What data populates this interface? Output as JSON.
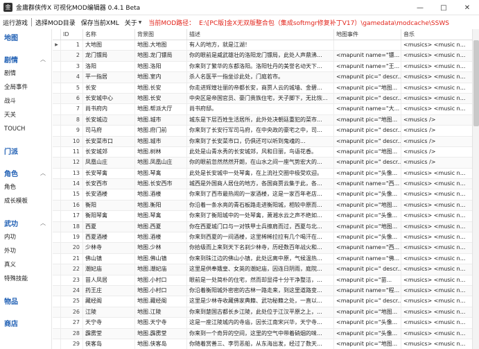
{
  "window": {
    "icon": "金",
    "title": "金庸群侠传X 可视化MOD编辑器 0.4.1 Beta",
    "buttons": [
      "—",
      "□",
      "✕"
    ]
  },
  "menu": {
    "run_game": "运行游戏",
    "select_mod": "选择MOD目录",
    "save_xml": "保存当前XML",
    "about": "关于",
    "path_label": "当前MOD路径：",
    "path_value": "E:\\[PC版]金X无双版整合包（集成softmgr修复补丁V17）\\gamedata\\modcache\\SSWS"
  },
  "sidebar": {
    "g1": "地图",
    "g2": "剧情",
    "g2_items": [
      "剧情",
      "全局事件",
      "战斗",
      "天关",
      "TOUCH"
    ],
    "g3": "门派",
    "g4": "角色",
    "g4_items": [
      "角色",
      "成长模板"
    ],
    "g5": "武功",
    "g5_items": [
      "内功",
      "外功",
      "真义",
      "特殊技能"
    ],
    "g6": "物品",
    "g7": "商店"
  },
  "grid": {
    "headers": [
      "ID",
      "名称",
      "背景图",
      "描述",
      "地图事件",
      "音乐"
    ],
    "rows": [
      [
        "1",
        "大地图",
        "地图.大地图",
        "有人的地方，就是江湖！",
        "",
        "<musics>  <music n..."
      ],
      [
        "2",
        "龙门镖局",
        "地图.龙门镖局",
        "你的眼前是威武雄壮的洛阳龙门镖局，此处人声鼎沸...",
        "<mapunit name=\"镖...",
        "<musics>  <music n..."
      ],
      [
        "3",
        "洛阳",
        "地图.洛阳",
        "你来到了繁华的东都洛阳。洛阳牡丹的美誉名动天下...",
        "<mapunit name=\"王...",
        "<musics>  <music n..."
      ],
      [
        "4",
        "平一指居",
        "地图.室内",
        "杀人名医平一指坐诊此处，门庭若市。",
        "<mapunit pic=\" descr...",
        "<musics>  <music n..."
      ],
      [
        "5",
        "长安",
        "地图.长安",
        "你走进辉煌壮丽的帝都长安，商贾人云的城墙、金碧...",
        "<mapunit pic=\"地图...",
        "<musics>  <music n..."
      ],
      [
        "6",
        "长安城中心",
        "地图.长安",
        "中央区是帝国官员、豪门贵族住宅，天子脚下，无比恢...",
        "<mapunit pic=\" descr...",
        "<musics>  <music n..."
      ],
      [
        "7",
        "尚书府内",
        "地图.帮派大厅",
        "尚书府邸。",
        "<mapunit name=\"大...",
        "<musics>  <music n..."
      ],
      [
        "8",
        "长安城边",
        "地图.城市",
        "城东是下层百姓生活居所，此外处决朝廷重犯的菜市...",
        "<mapunit pic=\"地图...",
        "<musics />"
      ],
      [
        "9",
        "司马府",
        "地图.府门前",
        "你来到了长安行军司马府，在中央政的豪宅之中，司...",
        "<mapunit pic=\" descr...",
        "<musics />"
      ],
      [
        "10",
        "长安菜市口",
        "地图.城市",
        "你来到了长安菜市口，仍俱还可以听到鬼魂的...",
        "<mapunit pic=\" descr...",
        "<musics />"
      ],
      [
        "11",
        "长安城郊",
        "地图.树林",
        "此处是山青水秀的长安城郊，风和日丽，鸟语花香。",
        "<mapunit pic=\"地图...",
        "<musics />"
      ],
      [
        "12",
        "凤凰山庄",
        "地图.凤凰山庄",
        "你的眼前忽然然然开朗，在山水之间一座气势宏大的...",
        "<mapunit pic=\" descr...",
        "<musics />"
      ],
      [
        "13",
        "长安琴禽",
        "地图.琴禽",
        "此处是长安城中一处琴禽，在上流社交圈中极受欢迎。",
        "<mapunit pic=\"头像...",
        "<musics>  <music n..."
      ],
      [
        "14",
        "长安西市",
        "地图.长安西市",
        "城西是外国商人居住的地方，各国商贾云集于此，各...",
        "<mapunit name=\"西...",
        "<musics>  <music n..."
      ],
      [
        "15",
        "长安酒楼",
        "地图.酒楼",
        "你来到了西市最热闹的一家酒楼，这是一家百年老店...",
        "<mapunit pic=\"头像...",
        "<musics>  <music n..."
      ],
      [
        "16",
        "衡阳",
        "地图.衡阳",
        "你沿着一条水亮的青石板路走进衡阳城，相较中原而...",
        "<mapunit pic=\"地图...",
        "<musics>  <music n..."
      ],
      [
        "17",
        "衡阳琴禽",
        "地图.琴禽",
        "你来到了衡阳城中的一处琴禽，萧湘水云之声不绝如...",
        "<mapunit pic=\"头像...",
        "<musics>  <music n..."
      ],
      [
        "18",
        "西夏",
        "地图.西夏",
        "你在西夏城门口与一对铁甲士兵擦肩而过，西夏与北...",
        "<mapunit pic=\"地图...",
        "<musics>  <music n..."
      ],
      [
        "19",
        "西夏酒楼",
        "地图.酒楼",
        "你来到西夏的一间酒楼，这里稀稀拉拉有几个喝汗在...",
        "<mapunit pic=\"头像...",
        "<musics>  <music n..."
      ],
      [
        "20",
        "少林寺",
        "地图.少林",
        "你拾级而上来到天下名刹少林寺，历经数百年战火和...",
        "<mapunit name=\"西...",
        "<musics>  <music n..."
      ],
      [
        "21",
        "佛山镇",
        "地图.佛山镇",
        "你来到珠江边的佛山小镇，此处远离中原，气候温热...",
        "<mapunit name=\"佛...",
        "<musics>  <music n..."
      ],
      [
        "22",
        "潮妃庙",
        "地图.潮妃庙",
        "这里是供奉娥皇、女英的潮妃庙，因连日阴雨，庭院...",
        "<mapunit pic=\" descr...",
        "<musics>  <music n..."
      ],
      [
        "23",
        "苗人凤居",
        "地图.小村口",
        "眼前是一处简朴的住宅，然而却显得十分干净整洁，...",
        "<mapunit pic=\"苗...",
        "<musics>  <music n..."
      ],
      [
        "24",
        "药王庄",
        "地图.小村口",
        "你沿着衡阳城外密密的古林一路走来，到这里道路变...",
        "<mapunit name=\"程...",
        "<musics>  <music n..."
      ],
      [
        "25",
        "藏经阁",
        "地图.藏经阁",
        "这里是少林寺收藏佛家典籍、武功秘籍之处，一直以...",
        "<mapunit pic=\" descr...",
        "<musics>  <music n..."
      ],
      [
        "26",
        "江陵",
        "地图.江陵",
        "你来到楚国古都长乡江陵，此处位于江汉平原之上，...",
        "<mapunit pic=\"地图...",
        "<musics>  <music n..."
      ],
      [
        "27",
        "天宁寺",
        "地图.天宁寺",
        "这是一座江陵城内的寺庙，因长江南宋兴华，天宁寺...",
        "<mapunit pic=\"头像...",
        "<musics>  <music n..."
      ],
      [
        "28",
        "霹雳堂",
        "地图.霹雳堂",
        "你来到一个奇异的空间，这里的空气中带着硝烟的味...",
        "<mapunit pic=\"头像...",
        "<musics>  <music n..."
      ],
      [
        "29",
        "侠客岛",
        "地图.侠客岛",
        "你随着赏善三、李罚恶船，从东海出发，经过了数天...",
        "<mapunit pic=\"地图...",
        "<musics>  <music n..."
      ],
      [
        "30",
        "侠客岛洞内",
        "地图.侠客岛洞内",
        "你在岛中随着走动，来到这个洞穴之中。众多中原武...",
        "<mapunit pic=\"头像...",
        "<musics>  <music n..."
      ]
    ]
  }
}
